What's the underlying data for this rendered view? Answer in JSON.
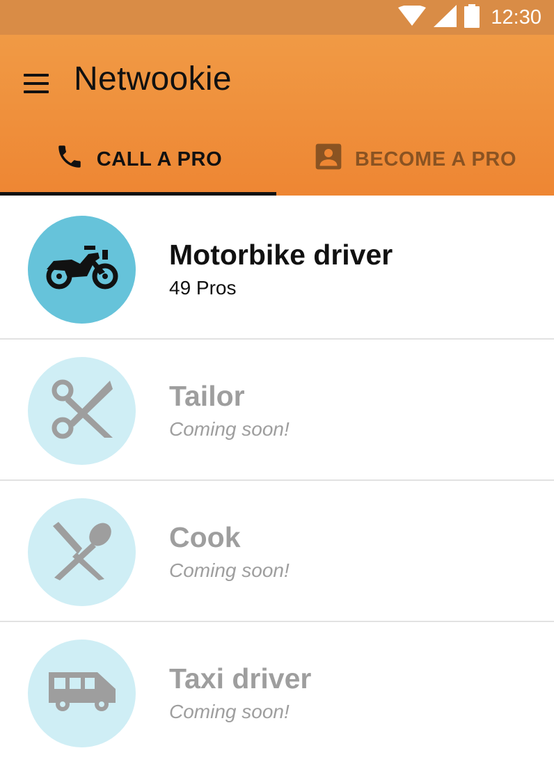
{
  "status_bar": {
    "time": "12:30",
    "icons": [
      "wifi-icon",
      "signal-icon",
      "battery-icon"
    ]
  },
  "app_bar": {
    "title": "Netwookie",
    "menu_icon": "hamburger-menu-icon"
  },
  "tabs": [
    {
      "label": "CALL A PRO",
      "icon": "phone-icon",
      "selected": true
    },
    {
      "label": "BECOME A PRO",
      "icon": "contact-card-icon",
      "selected": false
    }
  ],
  "categories": [
    {
      "title": "Motorbike driver",
      "subtitle": "49 Pros",
      "icon": "motorbike-icon",
      "active": true
    },
    {
      "title": "Tailor",
      "subtitle": "Coming soon!",
      "icon": "scissors-icon",
      "active": false
    },
    {
      "title": "Cook",
      "subtitle": "Coming soon!",
      "icon": "utensils-icon",
      "active": false
    },
    {
      "title": "Taxi driver",
      "subtitle": "Coming soon!",
      "icon": "van-icon",
      "active": false
    }
  ],
  "colors": {
    "app_bar": "#ee8633",
    "status_bar": "#d98c46",
    "active_circle": "#66c3da",
    "inactive_circle": "#cfeef5",
    "inactive_text": "#9e9e9e"
  }
}
